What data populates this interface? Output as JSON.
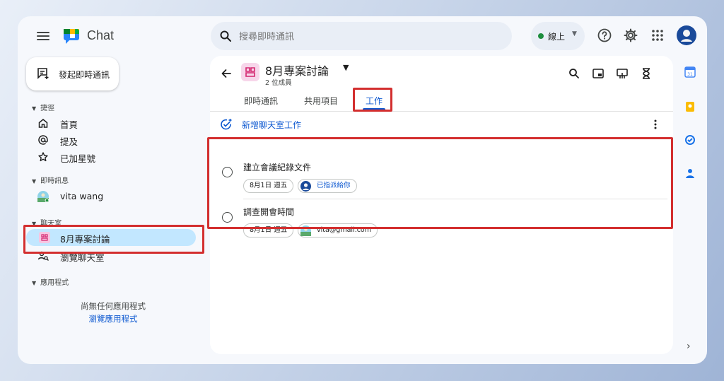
{
  "header": {
    "app_name": "Chat",
    "search_placeholder": "搜尋即時通訊",
    "status": "線上"
  },
  "sidebar": {
    "new_chat_label": "發起即時通訊",
    "sections": {
      "shortcuts": "捷徑",
      "dms": "即時訊息",
      "spaces": "聊天室",
      "apps": "應用程式"
    },
    "shortcuts": [
      {
        "label": "首頁",
        "icon": "home-icon"
      },
      {
        "label": "提及",
        "icon": "at-icon"
      },
      {
        "label": "已加星號",
        "icon": "star-icon"
      }
    ],
    "dm_items": [
      {
        "label": "vita wang",
        "icon": "avatar"
      }
    ],
    "space_items": [
      {
        "label": "8月專案討論",
        "icon": "space-icon"
      },
      {
        "label": "瀏覽聊天室",
        "icon": "browse-spaces-icon"
      }
    ],
    "apps_empty": "尚無任何應用程式",
    "apps_browse": "瀏覽應用程式"
  },
  "room": {
    "title": "8月專案討論",
    "subtitle": "2 位成員",
    "tabs": [
      {
        "label": "即時通訊",
        "active": false
      },
      {
        "label": "共用項目",
        "active": false
      },
      {
        "label": "工作",
        "active": true
      }
    ],
    "add_task_label": "新增聊天室工作",
    "tasks": [
      {
        "title": "建立會議紀錄文件",
        "date": "8月1日 週五",
        "assignee": "已指派給你"
      },
      {
        "title": "調查開會時間",
        "date": "8月1日 週五",
        "assignee": "vita@gmail.com"
      }
    ]
  },
  "colors": {
    "accent": "#0b57d0",
    "highlight": "#d32f2f",
    "active_item": "#c2e7ff",
    "online": "#1e8e3e"
  }
}
